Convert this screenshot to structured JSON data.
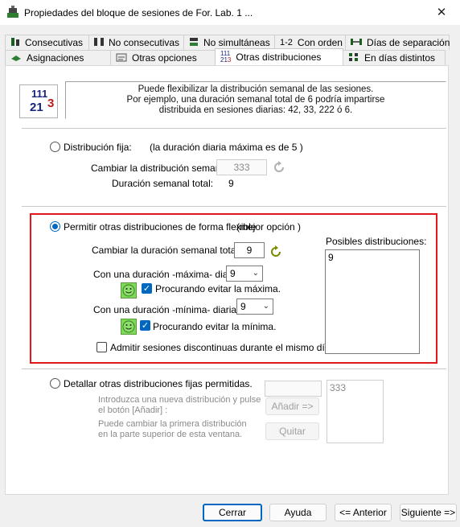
{
  "window": {
    "title": "Propiedades del bloque de sesiones de For. Lab. 1 ...",
    "close_glyph": "✕"
  },
  "tabs_top": [
    {
      "label": "Consecutivas",
      "icon": "consecutive-icon"
    },
    {
      "label": "No consecutivas",
      "icon": "non-consecutive-icon"
    },
    {
      "label": "No simultáneas",
      "icon": "non-simultaneous-icon"
    },
    {
      "label": "Con orden",
      "prefix": "1-2",
      "icon": "order-icon"
    },
    {
      "label": "Días de separación",
      "icon": "separation-days-icon"
    }
  ],
  "tabs_bottom": [
    {
      "label": "Asignaciones",
      "icon": "assignments-icon"
    },
    {
      "label": "Otras opciones",
      "icon": "other-options-icon"
    },
    {
      "label": "Otras distribuciones",
      "icon": "distributions-icon",
      "active": true
    },
    {
      "label": "En días distintos",
      "icon": "different-days-icon"
    }
  ],
  "info": {
    "icon_text": {
      "a": "111",
      "b": "21",
      "c": "3"
    },
    "lines": [
      "Puede flexibilizar la distribución semanal de las sesiones.",
      "Por ejemplo, una duración semanal total de 6 podría impartirse",
      "distribuida en sesiones diarias: 42, 33, 222 ó 6."
    ]
  },
  "fixed": {
    "label": "Distribución fija:",
    "note": "(la duración diaria máxima es de 5 )",
    "change_label": "Cambiar la distribución semanal:",
    "change_value": "333",
    "total_label": "Duración semanal total:",
    "total_value": "9",
    "selected": false
  },
  "flexible": {
    "label": "Permitir otras distribuciones de forma flexible",
    "note": "(mejor opción )",
    "selected": true,
    "change_total_label": "Cambiar la duración semanal total:",
    "change_total_value": "9",
    "max_label": "Con una duración -máxima- diaria:",
    "max_value": "9",
    "max_avoid_label": "Procurando evitar la máxima.",
    "max_avoid_checked": true,
    "min_label": "Con una duración -mínima- diaria:",
    "min_value": "9",
    "min_avoid_label": "Procurando evitar la mínima.",
    "min_avoid_checked": true,
    "discontinuous_label": "Admitir sesiones discontinuas durante el mismo día.",
    "discontinuous_checked": false,
    "possible_label": "Posibles distribuciones:",
    "possible_items": [
      "9"
    ]
  },
  "detail": {
    "label": "Detallar otras distribuciones fijas permitidas.",
    "selected": false,
    "hint1_a": "Introduzca una nueva distribución y pulse",
    "hint1_b": "el botón [Añadir] :",
    "hint2_a": "Puede cambiar la primera distribución",
    "hint2_b": "en la parte superior de esta ventana.",
    "add_label": "Añadir =>",
    "remove_label": "Quitar",
    "list_items": [
      "333"
    ]
  },
  "footer": {
    "close": "Cerrar",
    "help": "Ayuda",
    "prev": "<= Anterior",
    "next": "Siguiente =>"
  },
  "colors": {
    "highlight_frame": "#e0181b",
    "accent": "#0067c0"
  }
}
